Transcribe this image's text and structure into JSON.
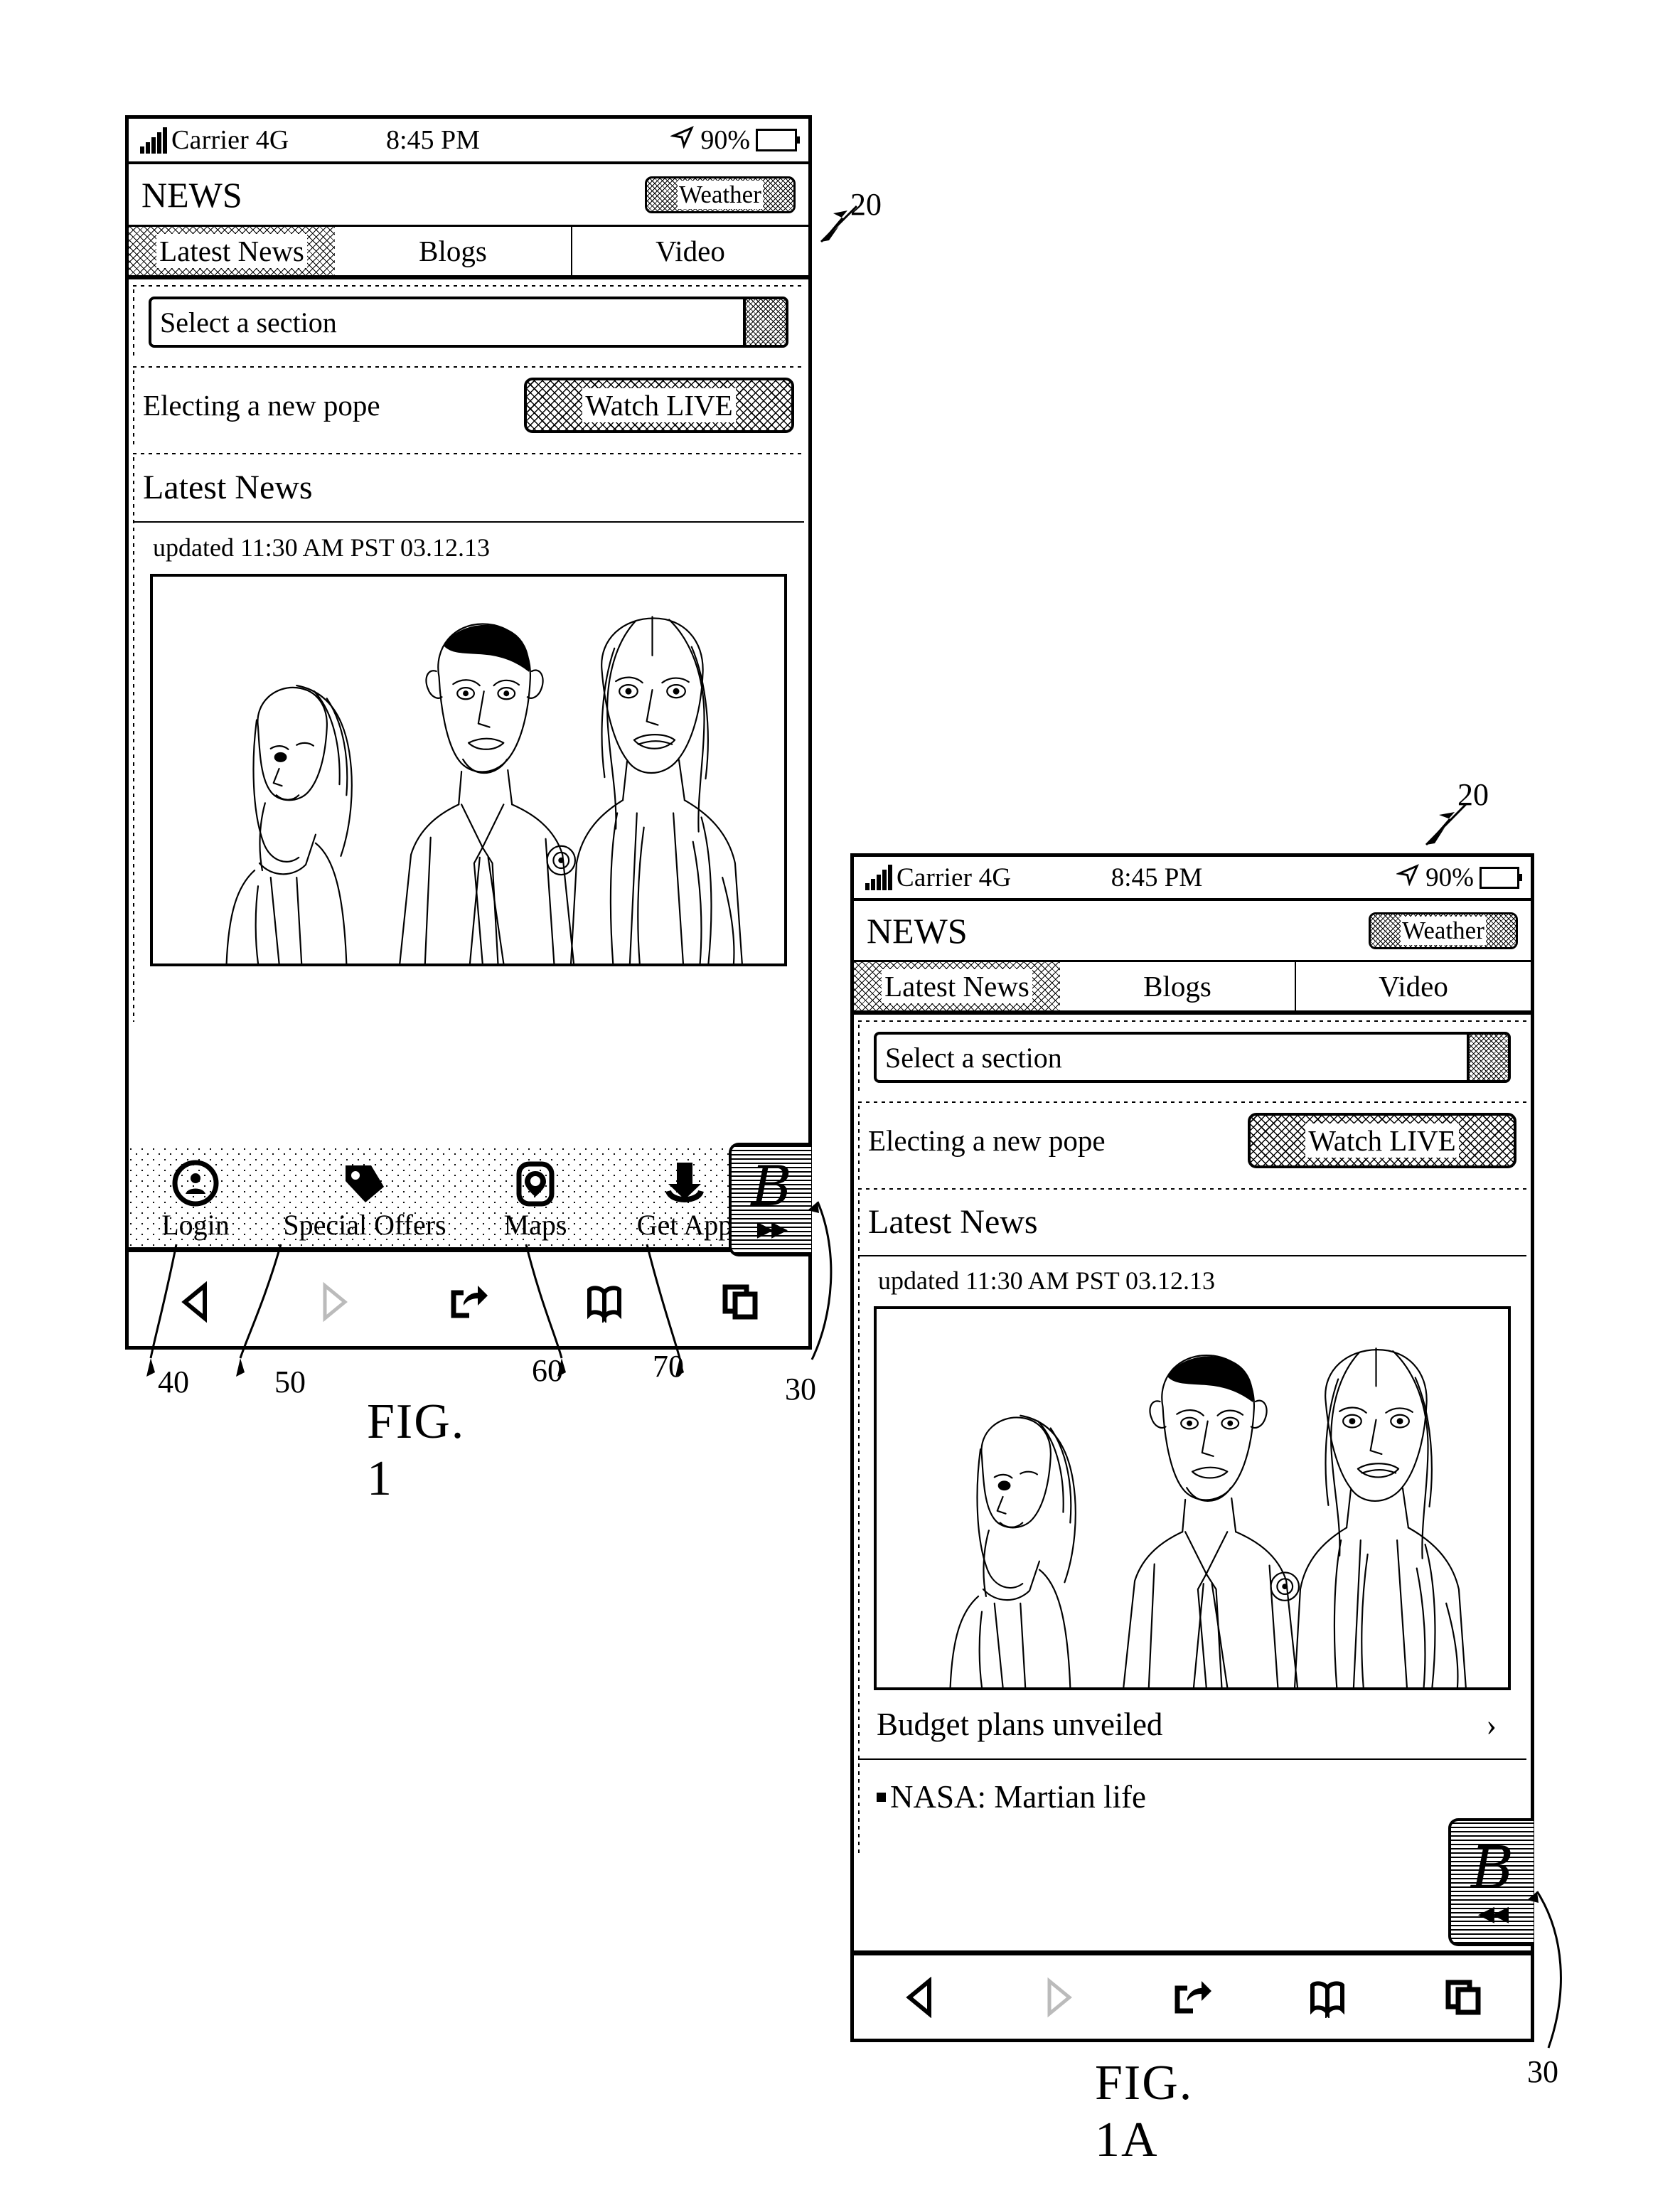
{
  "figures": [
    {
      "id": "fig1",
      "label": "FIG. 1",
      "status_bar": {
        "carrier": "Carrier 4G",
        "time": "8:45 PM",
        "battery_pct": "90%",
        "signal_icon": "signal-bars-icon",
        "location_icon": "location-arrow-icon",
        "battery_icon": "battery-icon"
      },
      "header": {
        "title": "NEWS",
        "weather_button": "Weather"
      },
      "tabs": [
        {
          "label": "Latest News",
          "active": true
        },
        {
          "label": "Blogs",
          "active": false
        },
        {
          "label": "Video",
          "active": false
        }
      ],
      "section_select": {
        "value": "Select a section",
        "arrow_icon": "dropdown-arrow-icon"
      },
      "promo": {
        "text": "Electing a new pope",
        "button": "Watch LIVE"
      },
      "latest_news": {
        "heading": "Latest News",
        "updated": "updated 11:30 AM PST 03.12.13",
        "photo_alt": "news-photo"
      },
      "app_bar": [
        {
          "label": "Login",
          "icon": "login-avatar-icon"
        },
        {
          "label": "Special Offers",
          "icon": "price-tag-icon"
        },
        {
          "label": "Maps",
          "icon": "map-pin-icon"
        },
        {
          "label": "Get App",
          "icon": "download-arrow-icon"
        }
      ],
      "b_tab": {
        "glyph": "B",
        "arrow": "▶▶",
        "direction": "expand-right"
      },
      "browser_bar": [
        {
          "icon": "back-arrow-icon",
          "enabled": true
        },
        {
          "icon": "forward-arrow-icon",
          "enabled": false
        },
        {
          "icon": "share-icon",
          "enabled": true
        },
        {
          "icon": "bookmarks-book-icon",
          "enabled": true
        },
        {
          "icon": "tabs-icon",
          "enabled": true
        }
      ],
      "callouts": [
        {
          "text": "20"
        },
        {
          "text": "40"
        },
        {
          "text": "50"
        },
        {
          "text": "60"
        },
        {
          "text": "70"
        },
        {
          "text": "30"
        }
      ]
    },
    {
      "id": "fig1a",
      "label": "FIG. 1A",
      "status_bar": {
        "carrier": "Carrier 4G",
        "time": "8:45 PM",
        "battery_pct": "90%",
        "signal_icon": "signal-bars-icon",
        "location_icon": "location-arrow-icon",
        "battery_icon": "battery-icon"
      },
      "header": {
        "title": "NEWS",
        "weather_button": "Weather"
      },
      "tabs": [
        {
          "label": "Latest News",
          "active": true
        },
        {
          "label": "Blogs",
          "active": false
        },
        {
          "label": "Video",
          "active": false
        }
      ],
      "section_select": {
        "value": "Select a section",
        "arrow_icon": "dropdown-arrow-icon"
      },
      "promo": {
        "text": "Electing a new pope",
        "button": "Watch LIVE"
      },
      "latest_news": {
        "heading": "Latest News",
        "updated": "updated 11:30 AM PST 03.12.13",
        "photo_alt": "news-photo"
      },
      "headlines": [
        {
          "text": "Budget plans unveiled",
          "chevron": "›",
          "bulleted": false
        },
        {
          "text": "NASA: Martian life",
          "chevron": "",
          "bulleted": true
        }
      ],
      "b_tab": {
        "glyph": "B",
        "arrow": "◀◀",
        "direction": "collapse-left"
      },
      "browser_bar": [
        {
          "icon": "back-arrow-icon",
          "enabled": true
        },
        {
          "icon": "forward-arrow-icon",
          "enabled": false
        },
        {
          "icon": "share-icon",
          "enabled": true
        },
        {
          "icon": "bookmarks-book-icon",
          "enabled": true
        },
        {
          "icon": "tabs-icon",
          "enabled": true
        }
      ],
      "callouts": [
        {
          "text": "20"
        },
        {
          "text": "30"
        }
      ]
    }
  ]
}
